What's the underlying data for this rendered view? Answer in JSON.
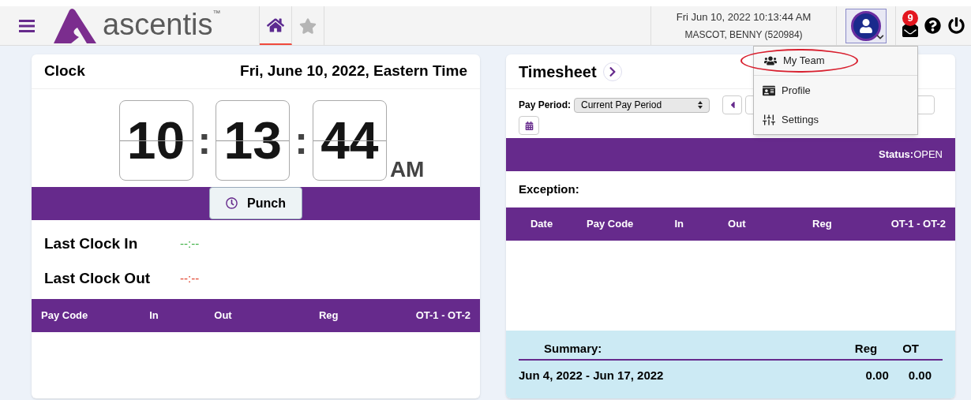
{
  "header": {
    "brand": "ascentis",
    "trademark": "™",
    "tabs": [
      {
        "kind": "home",
        "selected": true
      },
      {
        "kind": "star",
        "selected": false
      }
    ],
    "datetime": "Fri Jun 10, 2022 10:13:44 AM",
    "user": "MASCOT, BENNY (520984)",
    "mail_count": "9"
  },
  "user_menu": {
    "expanded": true,
    "items": [
      {
        "kind": "team",
        "label": "My Team",
        "highlighted": true
      },
      {
        "kind": "profile",
        "label": "Profile",
        "highlighted": false
      },
      {
        "kind": "settings",
        "label": "Settings",
        "highlighted": false
      }
    ]
  },
  "clock": {
    "title": "Clock",
    "date": "Fri, June 10, 2022, Eastern Time",
    "hours": "10",
    "minutes": "13",
    "seconds": "44",
    "separator": ":",
    "meridiem": "AM",
    "punch_button": "Punch",
    "last": [
      {
        "label": "Last Clock In",
        "value": "--:--",
        "color": "#3cb043"
      },
      {
        "label": "Last Clock Out",
        "value": "--:--",
        "color": "#e0402a"
      }
    ],
    "columns": [
      "Pay Code",
      "In",
      "Out",
      "Reg",
      "OT-1 - OT-2"
    ]
  },
  "timesheet": {
    "title": "Timesheet",
    "pay_period_label": "Pay Period:",
    "pay_period": "Current Pay Period",
    "status_label": "Status:",
    "status": "OPEN",
    "exception_label": "Exception:",
    "columns": [
      "Date",
      "Pay Code",
      "In",
      "Out",
      "Reg",
      "OT-1 - OT-2"
    ],
    "summary": {
      "title": "Summary:",
      "columns": [
        "Reg",
        "OT"
      ],
      "range": "Jun 4, 2022 - Jun 17, 2022",
      "values": [
        "0.00",
        "0.00"
      ]
    }
  }
}
